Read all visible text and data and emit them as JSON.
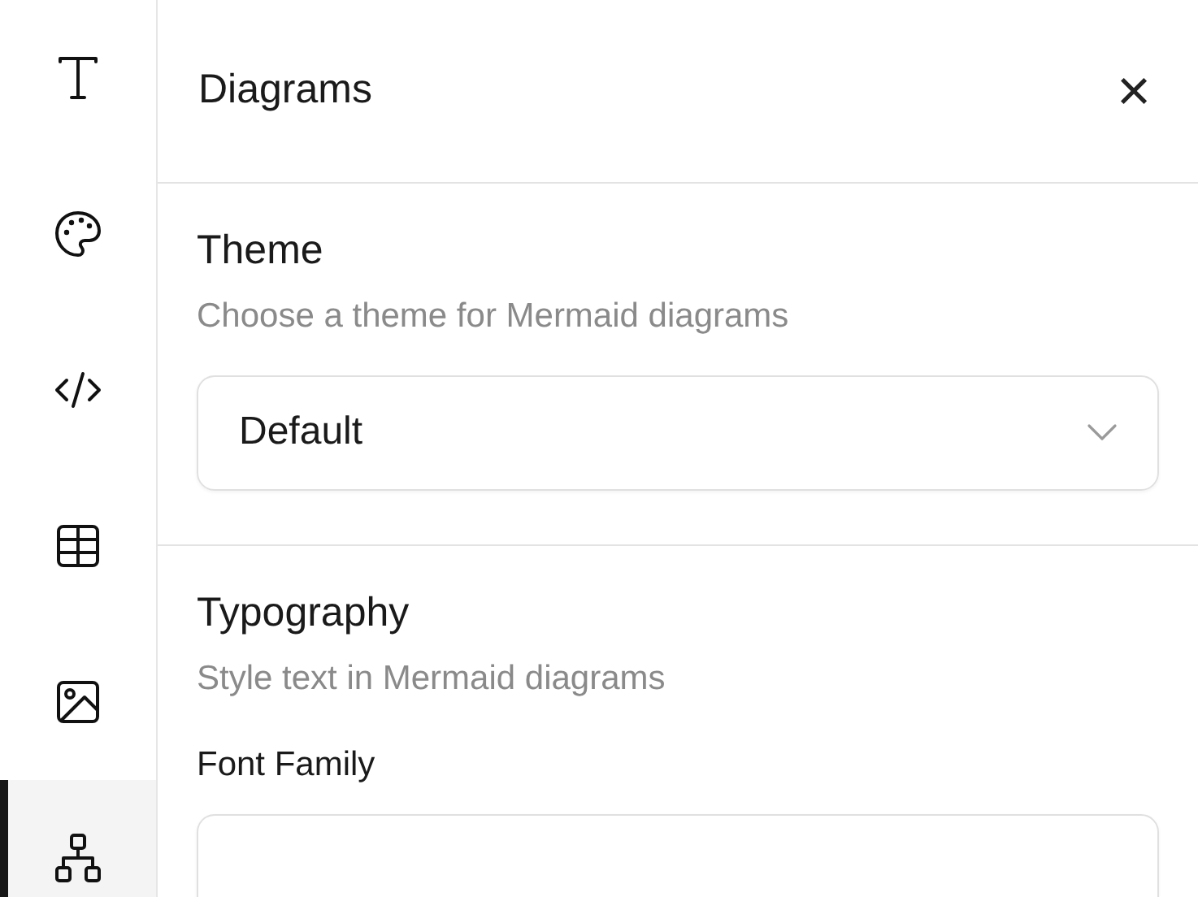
{
  "sidebar": {
    "items": [
      {
        "kind": "text",
        "selected": false
      },
      {
        "kind": "palette",
        "selected": false
      },
      {
        "kind": "code",
        "selected": false
      },
      {
        "kind": "table",
        "selected": false
      },
      {
        "kind": "image",
        "selected": false
      },
      {
        "kind": "diagram",
        "selected": true
      }
    ]
  },
  "panel": {
    "title": "Diagrams",
    "close": "×",
    "sections": [
      {
        "title": "Theme",
        "description": "Choose a theme for Mermaid diagrams",
        "fields": [
          {
            "kind": "select",
            "value": "Default"
          }
        ]
      },
      {
        "title": "Typography",
        "description": "Style text in Mermaid diagrams",
        "fields": [
          {
            "kind": "select",
            "label": "Font Family"
          }
        ]
      }
    ]
  }
}
